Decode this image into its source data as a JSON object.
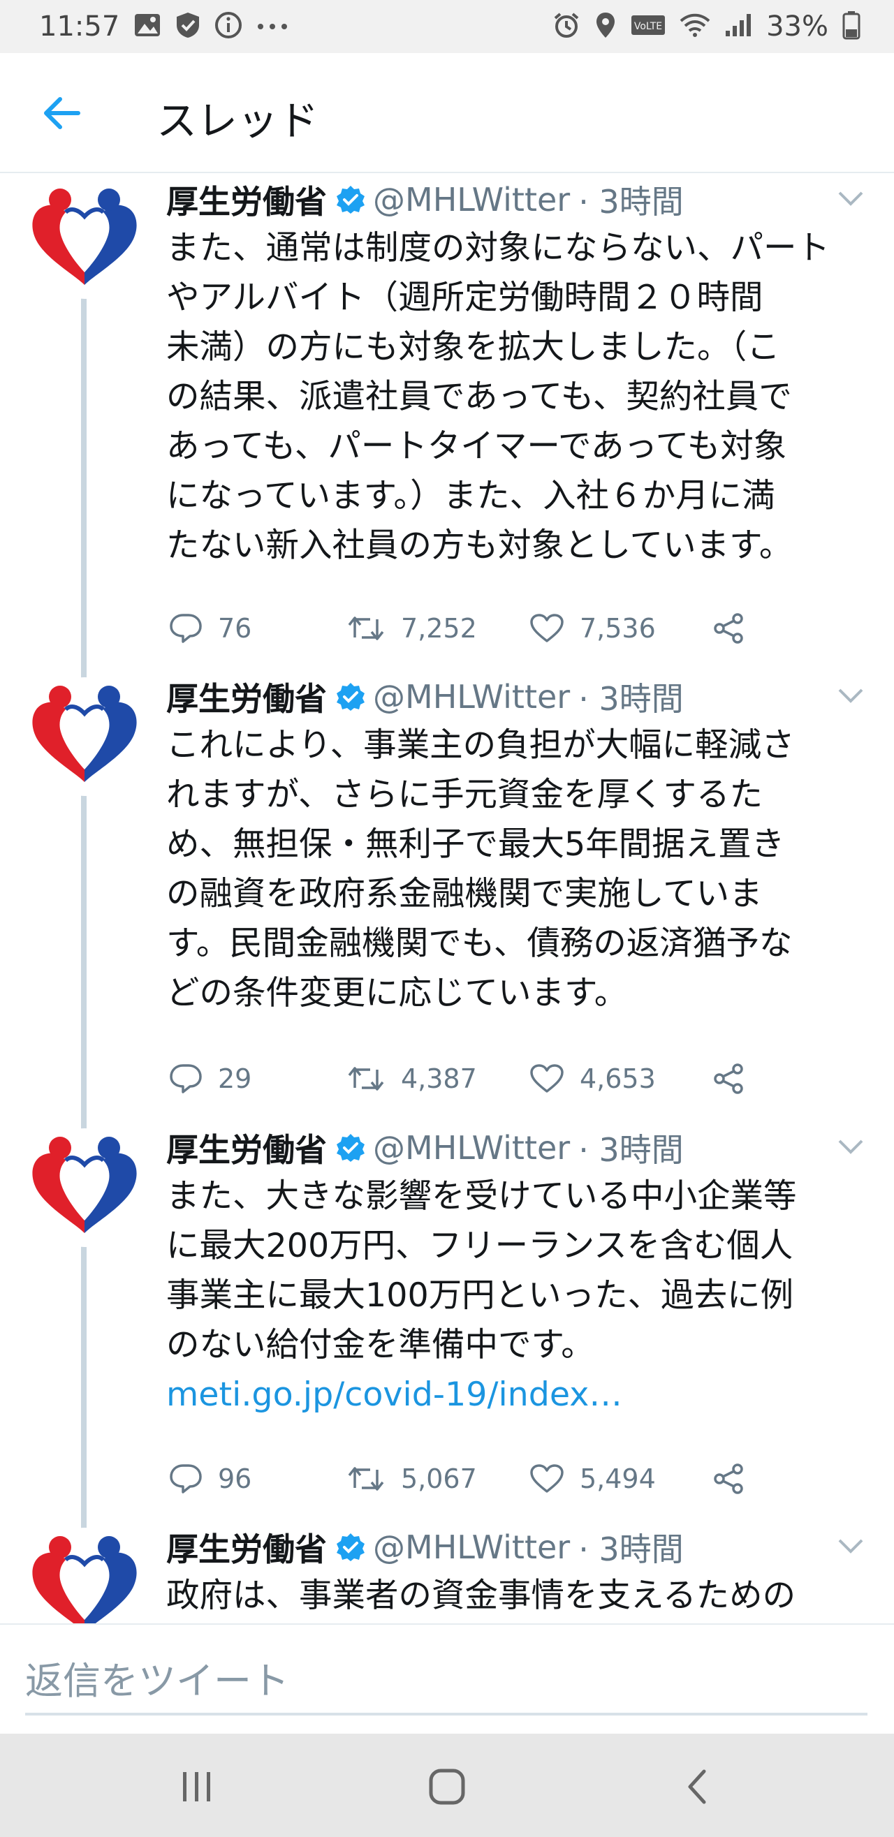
{
  "status_bar": {
    "time": "11:57",
    "left_icons": [
      "image-icon",
      "shield-check-icon",
      "info-icon",
      "more-icon"
    ],
    "right_icons": [
      "alarm-icon",
      "location-icon",
      "volte-icon",
      "wifi-icon",
      "signal-icon"
    ],
    "volte_label": "VoLTE",
    "battery_percent": "33%",
    "battery_level": 0.33
  },
  "header": {
    "back_icon": "arrow-left-icon",
    "title": "スレッド"
  },
  "colors": {
    "accent": "#1da1f2",
    "link": "#1b95e0",
    "secondary_text": "#657786",
    "thread_line": "#c9d6df",
    "logo_red": "#e0202a",
    "logo_blue": "#1f4aa8"
  },
  "tweets": [
    {
      "name": "厚生労働省",
      "handle": "@MHLWitter",
      "time": "· 3時間",
      "text": "また、通常は制度の対象にならない、パート\nやアルバイト（週所定労働時間２０時間\n未満）の方にも対象を拡大しました。（こ\nの結果、派遣社員であっても、契約社員で\nあっても、パートタイマーであっても対象\nになっています。）また、入社６か月に満\nたない新入社員の方も対象としています。",
      "link": "",
      "replies": "76",
      "retweets": "7,252",
      "likes": "7,536"
    },
    {
      "name": "厚生労働省",
      "handle": "@MHLWitter",
      "time": "· 3時間",
      "text": "これにより、事業主の負担が大幅に軽減さ\nれますが、さらに手元資金を厚くするた\nめ、無担保・無利子で最大5年間据え置き\nの融資を政府系金融機関で実施していま\nす。民間金融機関でも、債務の返済猶予な\nどの条件変更に応じています。",
      "link": "",
      "replies": "29",
      "retweets": "4,387",
      "likes": "4,653"
    },
    {
      "name": "厚生労働省",
      "handle": "@MHLWitter",
      "time": "· 3時間",
      "text": "また、大きな影響を受けている中小企業等\nに最大200万円、フリーランスを含む個人\n事業主に最大100万円といった、過去に例\nのない給付金を準備中です。",
      "link": "meti.go.jp/covid-19/index…",
      "replies": "96",
      "retweets": "5,067",
      "likes": "5,494"
    },
    {
      "name": "厚生労働省",
      "handle": "@MHLWitter",
      "time": "· 3時間",
      "text": "政府は、事業者の資金事情を支えるための",
      "link": "",
      "replies": "",
      "retweets": "",
      "likes": ""
    }
  ],
  "reply_bar": {
    "placeholder": "返信をツイート"
  },
  "nav_bar": {
    "buttons": [
      "recent-apps-icon",
      "home-icon",
      "back-icon"
    ]
  }
}
